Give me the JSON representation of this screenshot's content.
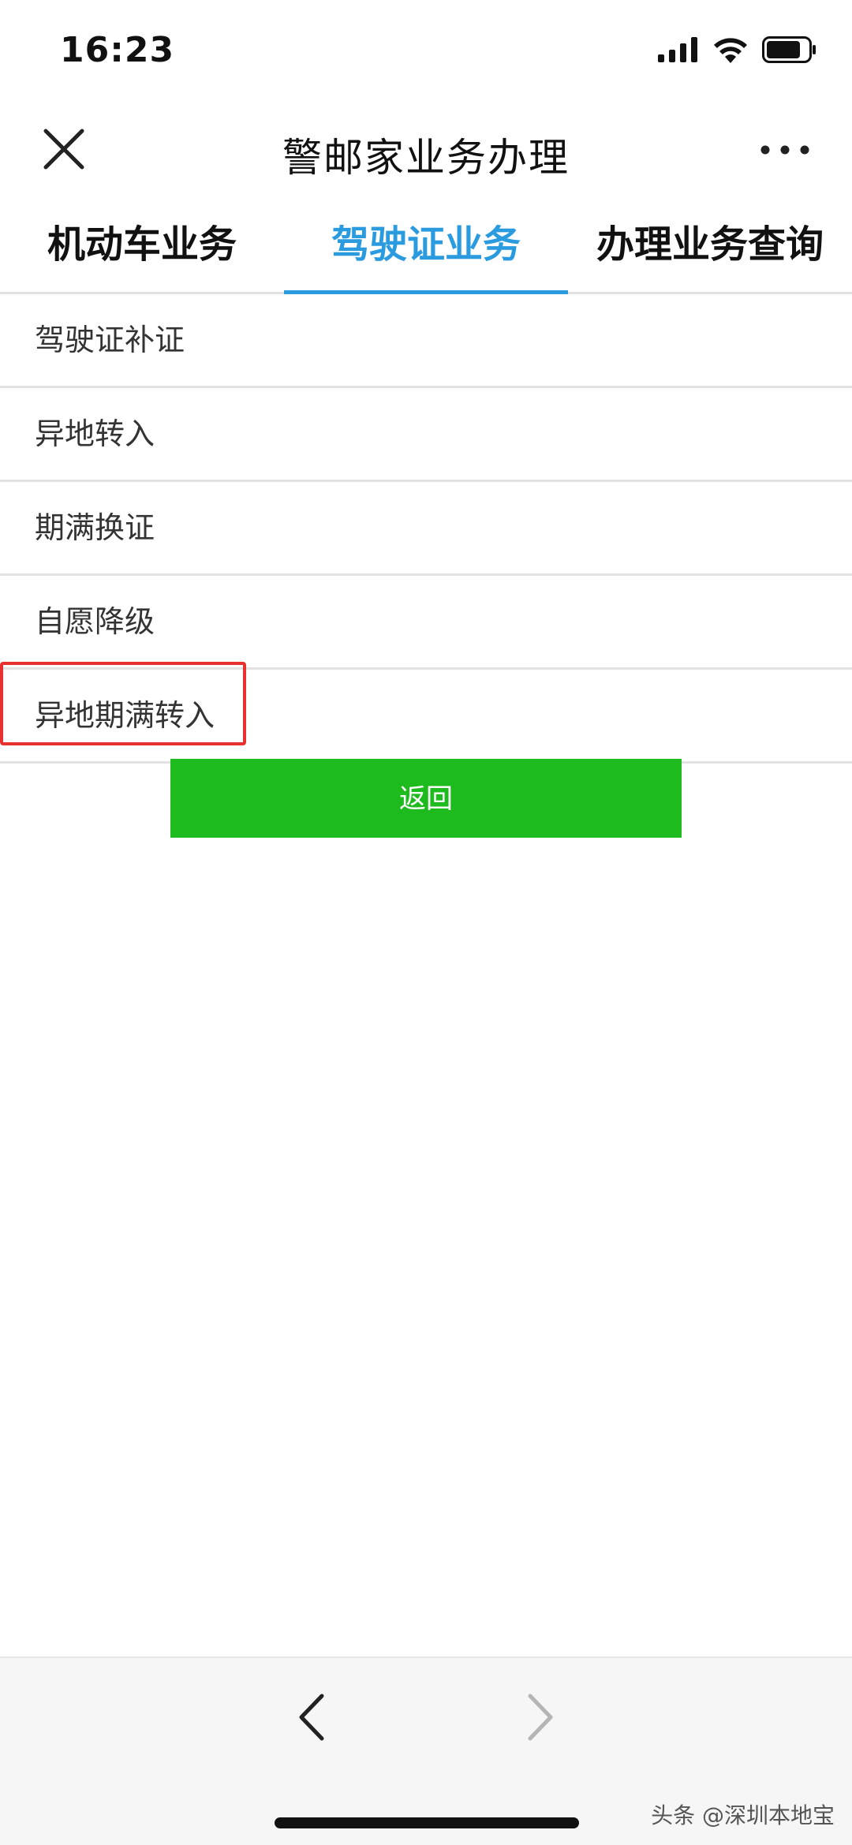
{
  "status_bar": {
    "time": "16:23",
    "icons": [
      "signal-icon",
      "wifi-icon",
      "battery-icon"
    ]
  },
  "nav": {
    "title": "警邮家业务办理",
    "close_icon": "close-icon",
    "more_icon": "more-icon"
  },
  "tabs": [
    {
      "label": "机动车业务",
      "active": false
    },
    {
      "label": "驾驶证业务",
      "active": true
    },
    {
      "label": "办理业务查询",
      "active": false
    }
  ],
  "list": {
    "items": [
      {
        "label": "驾驶证补证"
      },
      {
        "label": "异地转入"
      },
      {
        "label": "期满换证"
      },
      {
        "label": "自愿降级"
      },
      {
        "label": "异地期满转入",
        "highlighted": true
      }
    ]
  },
  "back_button": {
    "label": "返回"
  },
  "bottom_bar": {
    "back_icon": "chevron-left-icon",
    "forward_icon": "chevron-right-icon"
  },
  "watermark": "头条 @深圳本地宝",
  "colors": {
    "accent": "#2b9be0",
    "button_green": "#1dbb1d",
    "highlight_red": "#e8312f",
    "divider": "#e2e2e2"
  }
}
